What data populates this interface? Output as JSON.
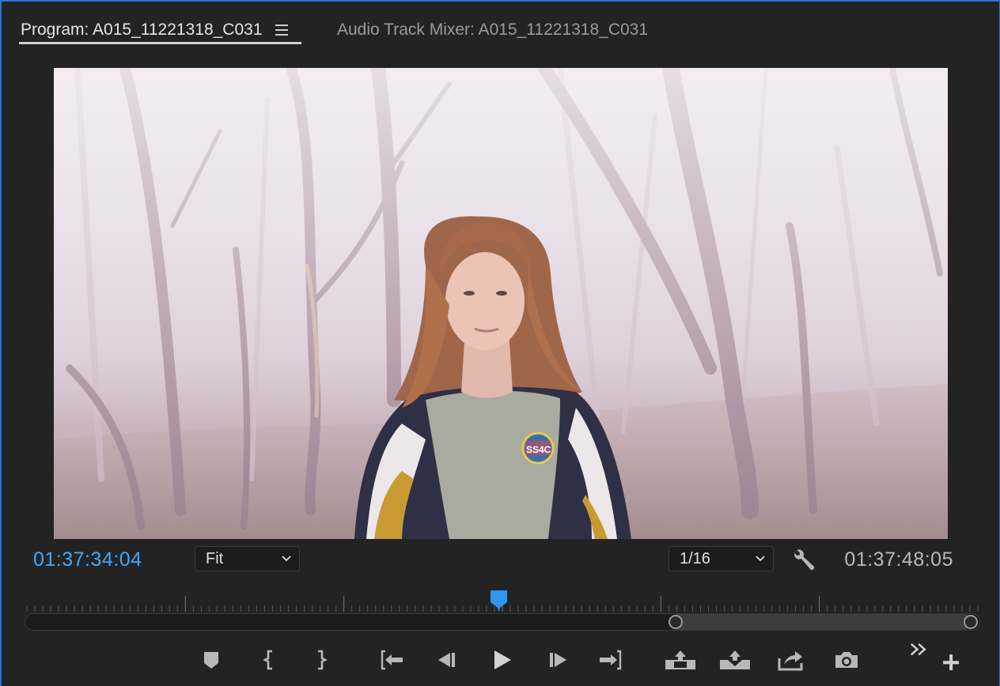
{
  "tabs": [
    {
      "label": "Program: A015_11221318_C031",
      "active": true
    },
    {
      "label": "Audio Track Mixer: A015_11221318_C031",
      "active": false
    }
  ],
  "program": {
    "current_timecode": "01:37:34:04",
    "duration_timecode": "01:37:48:05",
    "zoom_select": "Fit",
    "resolution_select": "1/16",
    "playhead_fraction": 0.496,
    "zoom_range": [
      0.683,
      0.988
    ]
  },
  "video_frame": {
    "description_icon": "video-frame",
    "badge_text": "SS4C"
  },
  "transport": [
    {
      "name": "add-marker-button",
      "icon": "marker-icon"
    },
    {
      "name": "mark-in-button",
      "icon": "mark-in-icon"
    },
    {
      "name": "mark-out-button",
      "icon": "mark-out-icon"
    },
    {
      "name": "go-to-in-button",
      "icon": "go-to-in-icon"
    },
    {
      "name": "step-back-button",
      "icon": "step-back-icon"
    },
    {
      "name": "play-button",
      "icon": "play-icon"
    },
    {
      "name": "step-forward-button",
      "icon": "step-forward-icon"
    },
    {
      "name": "go-to-out-button",
      "icon": "go-to-out-icon"
    },
    {
      "name": "lift-button",
      "icon": "lift-icon"
    },
    {
      "name": "extract-button",
      "icon": "extract-icon"
    },
    {
      "name": "export-frame-button",
      "icon": "export-icon"
    },
    {
      "name": "camera-button",
      "icon": "camera-icon"
    },
    {
      "name": "more-controls-button",
      "icon": "chevron-double-right-icon"
    },
    {
      "name": "button-editor-button",
      "icon": "plus-icon"
    }
  ],
  "colors": {
    "accent_timecode": "#3ea8ff",
    "panel_background": "#232323",
    "focus_border": "#2d6fd6"
  }
}
